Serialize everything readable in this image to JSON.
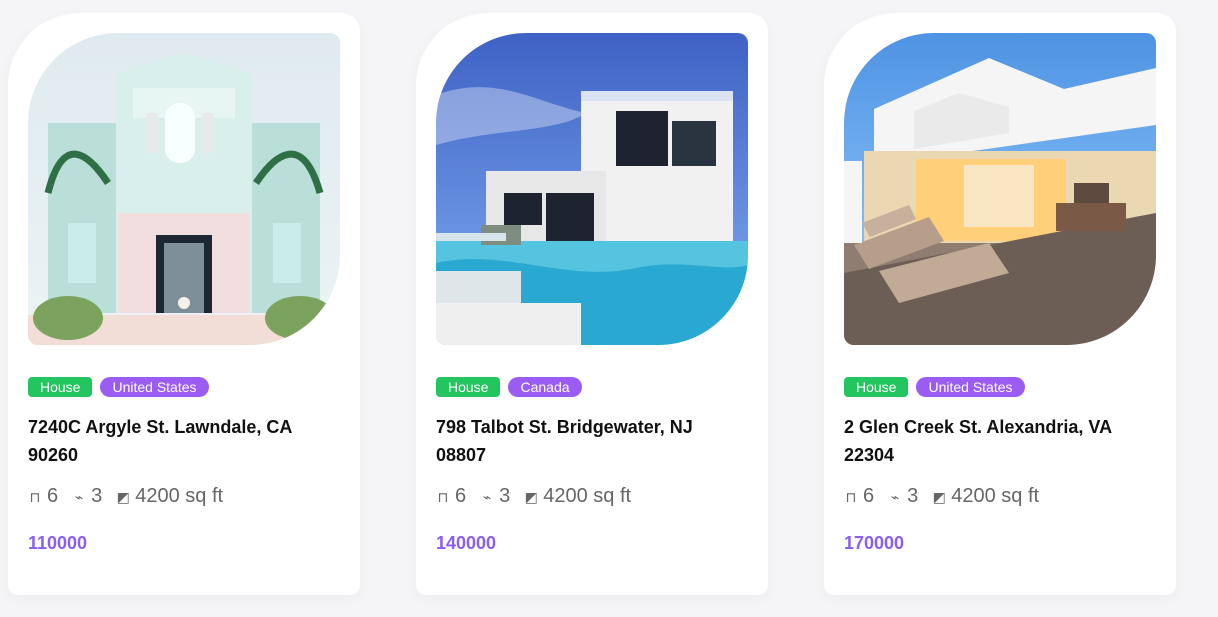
{
  "cards": [
    {
      "tag_type": "House",
      "tag_country": "United States",
      "address": "7240C Argyle St. Lawndale, CA 90260",
      "beds": "6",
      "baths": "3",
      "area": "4200 sq ft",
      "price": "110000",
      "image": "house-1"
    },
    {
      "tag_type": "House",
      "tag_country": "Canada",
      "address": "798 Talbot St. Bridgewater, NJ 08807",
      "beds": "6",
      "baths": "3",
      "area": "4200 sq ft",
      "price": "140000",
      "image": "house-2"
    },
    {
      "tag_type": "House",
      "tag_country": "United States",
      "address": "2 Glen Creek St. Alexandria, VA 22304",
      "beds": "6",
      "baths": "3",
      "area": "4200 sq ft",
      "price": "170000",
      "image": "house-3"
    }
  ],
  "icons": {
    "bed": "bed-icon",
    "bath": "bath-icon",
    "area": "area-icon"
  },
  "colors": {
    "tag_house": "#22c55e",
    "tag_country": "#9b5cf4",
    "price": "#8b5cf6"
  }
}
